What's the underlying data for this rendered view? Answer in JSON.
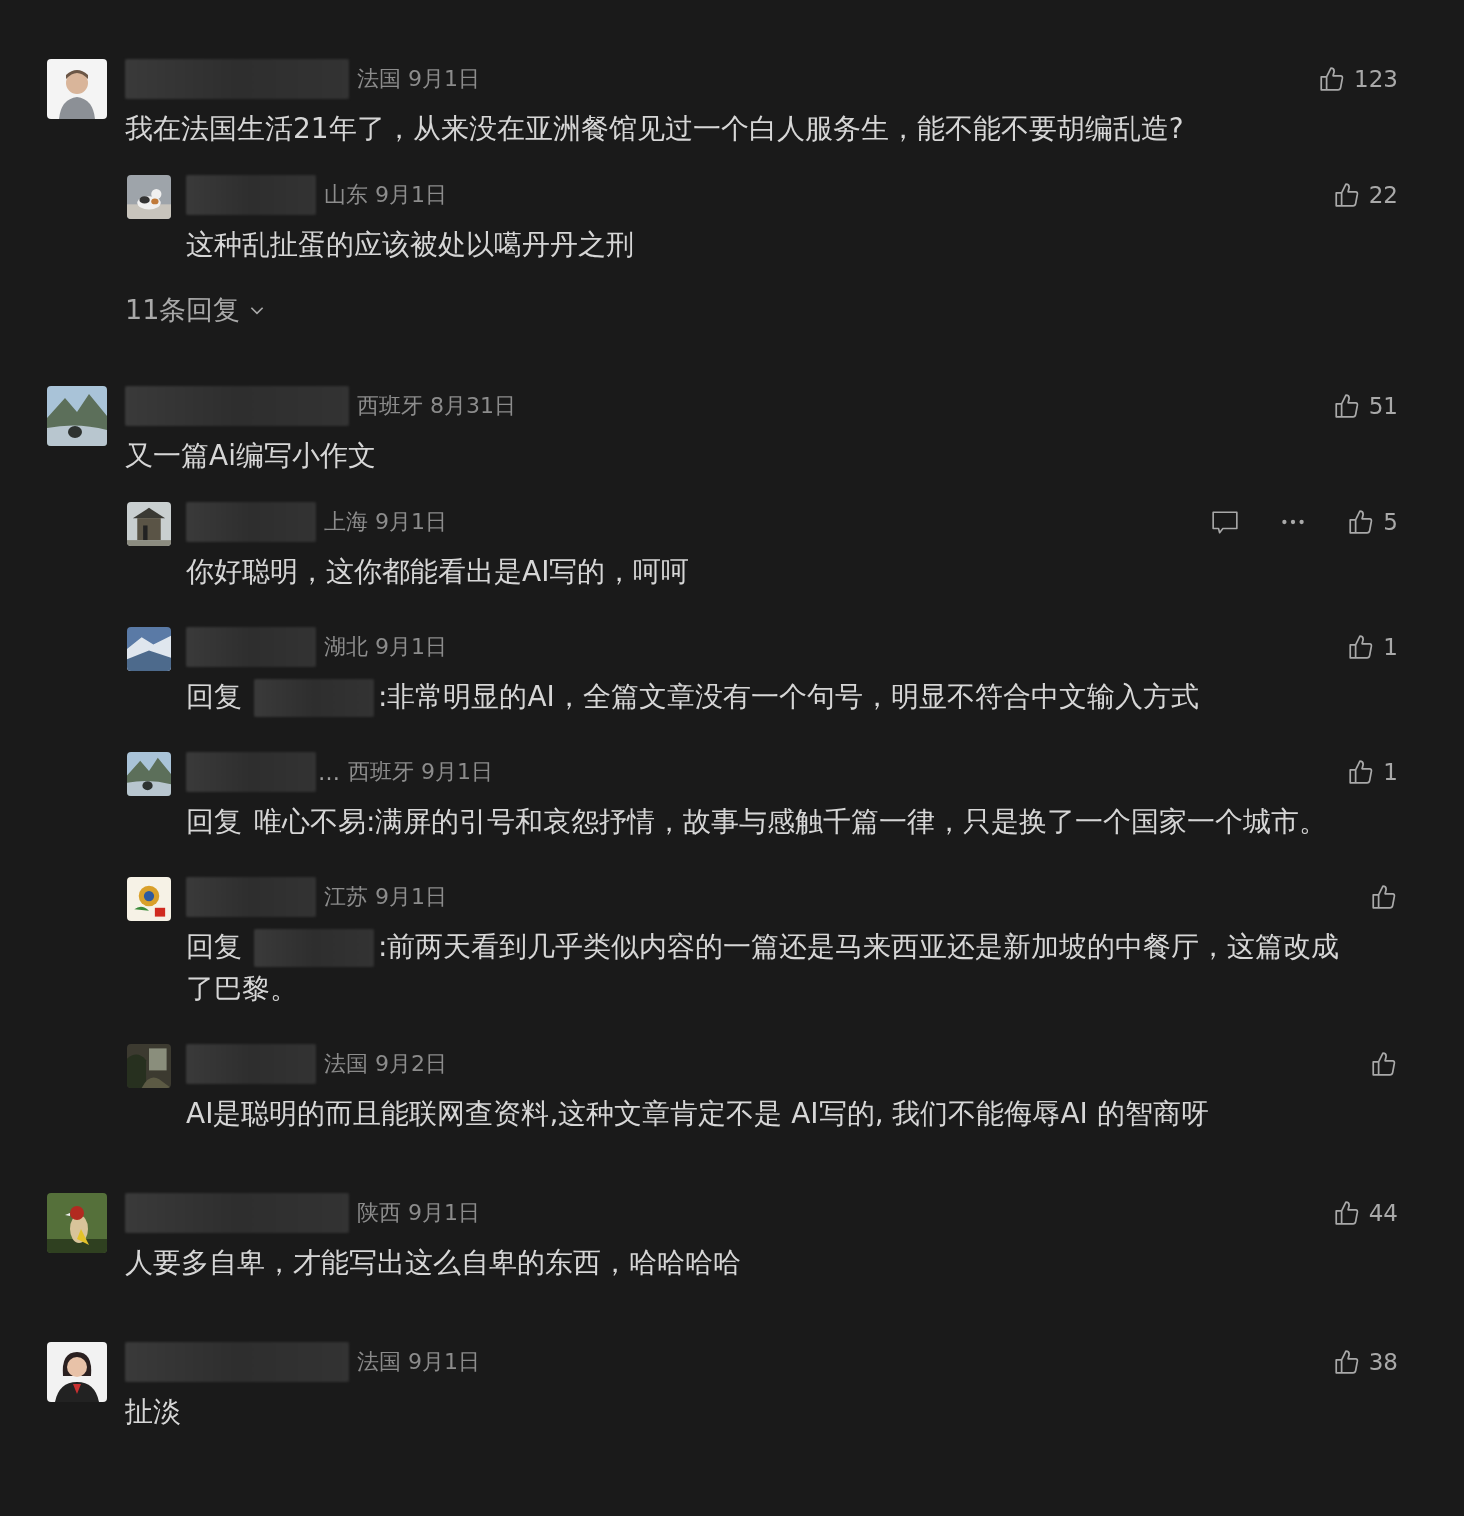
{
  "comments": [
    {
      "name_hidden": true,
      "location": "法国",
      "date": "9月1日",
      "likes": "123",
      "text": "我在法国生活21年了，从来没在亚洲餐馆见过一个白人服务生，能不能不要胡编乱造?",
      "replies": [
        {
          "name_hidden": true,
          "location": "山东",
          "date": "9月1日",
          "likes": "22",
          "hovered": false,
          "text": "这种乱扯蛋的应该被处以噶丹丹之刑"
        }
      ],
      "more_replies": "11条回复"
    },
    {
      "name_hidden": true,
      "location": "西班牙",
      "date": "8月31日",
      "likes": "51",
      "text": "又一篇Ai编写小作文",
      "replies": [
        {
          "name_hidden": true,
          "location": "上海",
          "date": "9月1日",
          "likes": "5",
          "hovered": true,
          "text": "你好聪明，这你都能看出是AI写的，呵呵"
        },
        {
          "name_hidden": true,
          "location": "湖北",
          "date": "9月1日",
          "likes": "1",
          "hovered": false,
          "reply_label": "回复",
          "mention_hidden": true,
          "text": ":非常明显的AI，全篇文章没有一个句号，明显不符合中文输入方式"
        },
        {
          "name_hidden": true,
          "name_suffix": "…",
          "location": "西班牙",
          "date": "9月1日",
          "likes": "1",
          "hovered": false,
          "reply_label": "回复",
          "mention": "唯心不易",
          "text": ":满屏的引号和哀怨抒情，故事与感触千篇一律，只是换了一个国家一个城市。"
        },
        {
          "name_hidden": true,
          "location": "江苏",
          "date": "9月1日",
          "hovered": false,
          "reply_label": "回复",
          "mention_hidden": true,
          "text": ":前两天看到几乎类似内容的一篇还是马来西亚还是新加坡的中餐厅，这篇改成了巴黎。"
        },
        {
          "name_hidden": true,
          "location": "法国",
          "date": "9月2日",
          "hovered": false,
          "text": "AI是聪明的而且能联网查资料,这种文章肯定不是 AI写的, 我们不能侮辱AI 的智商呀"
        }
      ]
    },
    {
      "name_hidden": true,
      "location": "陕西",
      "date": "9月1日",
      "likes": "44",
      "text": "人要多自卑，才能写出这么自卑的东西，哈哈哈哈"
    },
    {
      "name_hidden": true,
      "location": "法国",
      "date": "9月1日",
      "likes": "38",
      "text": "扯淡"
    }
  ]
}
